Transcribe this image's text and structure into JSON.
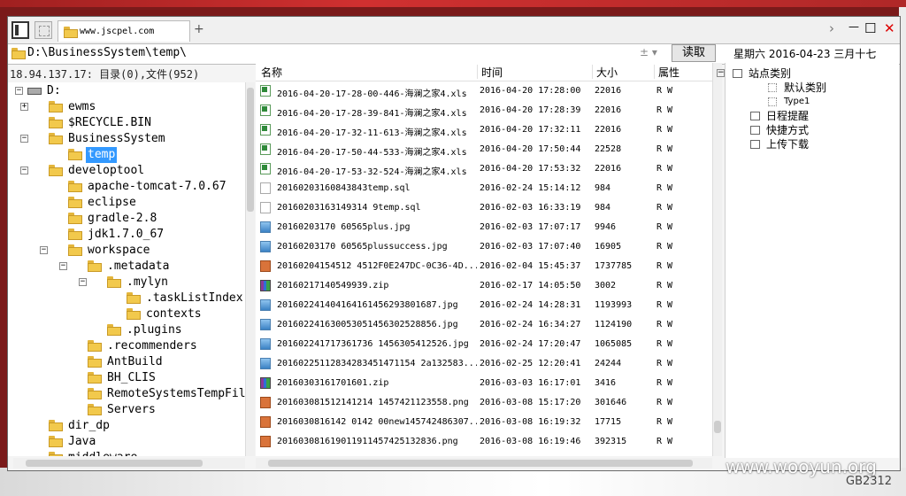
{
  "tab": {
    "title": "www.jscpel.com",
    "new_tab": "+"
  },
  "window_controls": {
    "forward": "›",
    "minimize": "—",
    "maximize": "☐",
    "close": "✕"
  },
  "address": {
    "path": "D:\\BusinessSystem\\temp\\",
    "dropdown": "± ▾",
    "read_button": "读取"
  },
  "date": "星期六  2016-04-23  三月十七",
  "status": "18.94.137.17:    目录(0),文件(952)",
  "tree": [
    {
      "label": "D:",
      "indent": 0,
      "exp": "⊟",
      "drive": true
    },
    {
      "label": "ewms",
      "indent": 1,
      "exp": "+"
    },
    {
      "label": "$RECYCLE.BIN",
      "indent": 1
    },
    {
      "label": "BusinessSystem",
      "indent": 1,
      "exp": "−"
    },
    {
      "label": "temp",
      "indent": 2,
      "selected": true
    },
    {
      "label": "developtool",
      "indent": 1,
      "exp": "−"
    },
    {
      "label": "apache-tomcat-7.0.67",
      "indent": 2
    },
    {
      "label": "eclipse",
      "indent": 2
    },
    {
      "label": "gradle-2.8",
      "indent": 2
    },
    {
      "label": "jdk1.7.0_67",
      "indent": 2
    },
    {
      "label": "workspace",
      "indent": 2,
      "exp": "−"
    },
    {
      "label": ".metadata",
      "indent": 3,
      "exp": "−"
    },
    {
      "label": ".mylyn",
      "indent": 4,
      "exp": "−"
    },
    {
      "label": ".taskListIndex",
      "indent": 5
    },
    {
      "label": "contexts",
      "indent": 5
    },
    {
      "label": ".plugins",
      "indent": 4
    },
    {
      "label": ".recommenders",
      "indent": 3
    },
    {
      "label": "AntBuild",
      "indent": 3
    },
    {
      "label": "BH_CLIS",
      "indent": 3
    },
    {
      "label": "RemoteSystemsTempFil",
      "indent": 3
    },
    {
      "label": "Servers",
      "indent": 3
    },
    {
      "label": "dir_dp",
      "indent": 1
    },
    {
      "label": "Java",
      "indent": 1
    },
    {
      "label": "middleware",
      "indent": 1
    }
  ],
  "columns": {
    "name": "名称",
    "time": "时间",
    "size": "大小",
    "attr": "属性"
  },
  "files": [
    {
      "name": "2016-04-20-17-28-00-446-海澜之家4.xls",
      "time": "2016-04-20 17:28:00",
      "size": "22016",
      "attr": "R W",
      "type": "xls"
    },
    {
      "name": "2016-04-20-17-28-39-841-海澜之家4.xls",
      "time": "2016-04-20 17:28:39",
      "size": "22016",
      "attr": "R W",
      "type": "xls"
    },
    {
      "name": "2016-04-20-17-32-11-613-海澜之家4.xls",
      "time": "2016-04-20 17:32:11",
      "size": "22016",
      "attr": "R W",
      "type": "xls"
    },
    {
      "name": "2016-04-20-17-50-44-533-海澜之家4.xls",
      "time": "2016-04-20 17:50:44",
      "size": "22528",
      "attr": "R W",
      "type": "xls"
    },
    {
      "name": "2016-04-20-17-53-32-524-海澜之家4.xls",
      "time": "2016-04-20 17:53:32",
      "size": "22016",
      "attr": "R W",
      "type": "xls"
    },
    {
      "name": "20160203160843843temp.sql",
      "time": "2016-02-24 15:14:12",
      "size": "984",
      "attr": "R W",
      "type": "sql"
    },
    {
      "name": "20160203163149314 9temp.sql",
      "time": "2016-02-03 16:33:19",
      "size": "984",
      "attr": "R W",
      "type": "sql"
    },
    {
      "name": "20160203170 60565plus.jpg",
      "time": "2016-02-03 17:07:17",
      "size": "9946",
      "attr": "R W",
      "type": "img"
    },
    {
      "name": "20160203170 60565plussuccess.jpg",
      "time": "2016-02-03 17:07:40",
      "size": "16905",
      "attr": "R W",
      "type": "img"
    },
    {
      "name": "20160204154512 4512F0E247DC-0C36-4D...",
      "time": "2016-02-04 15:45:37",
      "size": "1737785",
      "attr": "R W",
      "type": "png"
    },
    {
      "name": "20160217140549939.zip",
      "time": "2016-02-17 14:05:50",
      "size": "3002",
      "attr": "R W",
      "type": "zip"
    },
    {
      "name": "201602241404164161456293801687.jpg",
      "time": "2016-02-24 14:28:31",
      "size": "1193993",
      "attr": "R W",
      "type": "img"
    },
    {
      "name": "201602241630053051456302528856.jpg",
      "time": "2016-02-24 16:34:27",
      "size": "1124190",
      "attr": "R W",
      "type": "img"
    },
    {
      "name": "201602241717361736 1456305412526.jpg",
      "time": "2016-02-24 17:20:47",
      "size": "1065085",
      "attr": "R W",
      "type": "img"
    },
    {
      "name": "20160225112834283451471154 2a132583...",
      "time": "2016-02-25 12:20:41",
      "size": "24244",
      "attr": "R W",
      "type": "img"
    },
    {
      "name": "20160303161701601.zip",
      "time": "2016-03-03 16:17:01",
      "size": "3416",
      "attr": "R W",
      "type": "zip"
    },
    {
      "name": "201603081512141214 1457421123558.png",
      "time": "2016-03-08 15:17:20",
      "size": "301646",
      "attr": "R W",
      "type": "png"
    },
    {
      "name": "2016030816142 0142 00new145742486307...",
      "time": "2016-03-08 16:19:32",
      "size": "17715",
      "attr": "R W",
      "type": "png"
    },
    {
      "name": "201603081619011911457425132836.png",
      "time": "2016-03-08 16:19:46",
      "size": "392315",
      "attr": "R W",
      "type": "png"
    }
  ],
  "right_tree": [
    {
      "label": "站点类别",
      "indent": 0,
      "exp": "−",
      "kind": "box"
    },
    {
      "label": "默认类别",
      "indent": 2,
      "kind": "dot"
    },
    {
      "label": "Type1",
      "indent": 2,
      "kind": "dot",
      "small": true
    },
    {
      "label": "日程提醒",
      "indent": 1,
      "kind": "box"
    },
    {
      "label": "快捷方式",
      "indent": 1,
      "kind": "box"
    },
    {
      "label": "上传下载",
      "indent": 1,
      "kind": "box"
    }
  ],
  "watermark": "www.wooyun.org",
  "watermark_id": "GB2312"
}
